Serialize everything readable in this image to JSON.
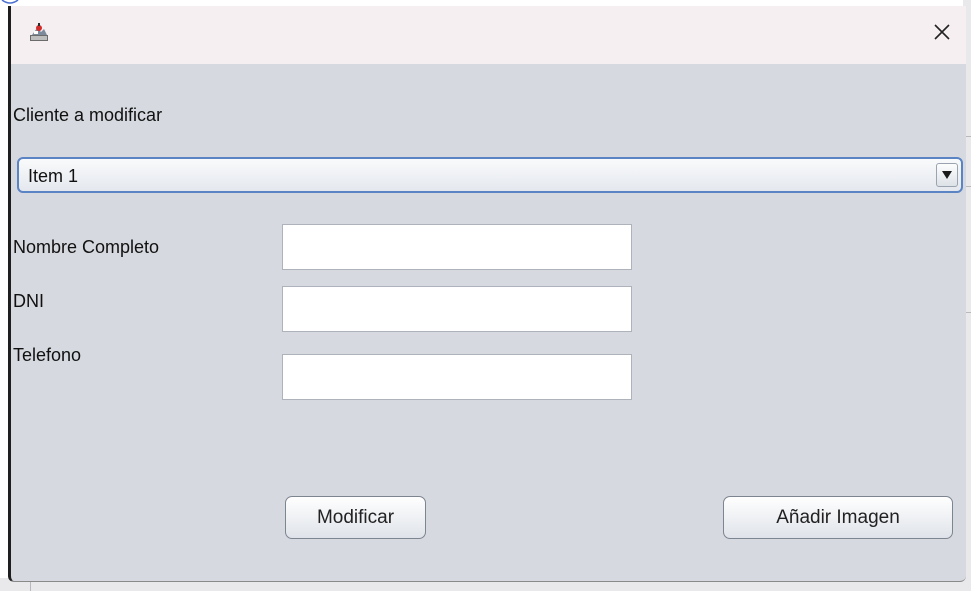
{
  "window": {
    "close_glyph": "✕",
    "icon": "java-app-icon"
  },
  "form": {
    "client_label": "Cliente a modificar",
    "client_select_value": "Item 1",
    "name_label": "Nombre Completo",
    "name_value": "",
    "dni_label": "DNI",
    "dni_value": "",
    "phone_label": "Telefono",
    "phone_value": ""
  },
  "buttons": {
    "modify_label": "Modificar",
    "add_image_label": "Añadir Imagen"
  },
  "colors": {
    "window_bg": "#d6d9df",
    "titlebar_bg": "#f6eff2",
    "combo_focus_border": "#5b84c4"
  }
}
